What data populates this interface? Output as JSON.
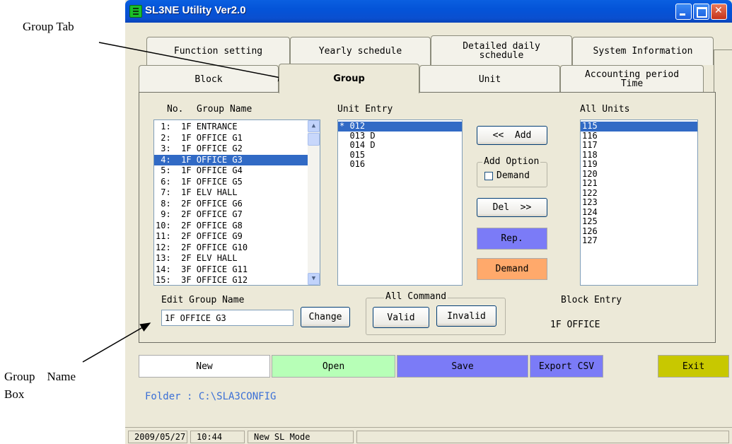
{
  "annotations": {
    "group_tab": "Group Tab",
    "group_name_box_line1": "Group　Name",
    "group_name_box_line2": "Box"
  },
  "window": {
    "title": "SL3NE Utility Ver2.0",
    "accent": "#0454d8"
  },
  "tabs_top": [
    {
      "label": "Function setting"
    },
    {
      "label": "Yearly schedule"
    },
    {
      "label": "Detailed daily\nschedule"
    },
    {
      "label": "System Information"
    }
  ],
  "tabs_bottom": [
    {
      "label": "Block"
    },
    {
      "label": "Group",
      "active": true
    },
    {
      "label": "Unit"
    },
    {
      "label": "Accounting period\nTime"
    }
  ],
  "group_list": {
    "header_no": "No.",
    "header_name": "Group Name",
    "selected_index": 3,
    "items": [
      " 1:  1F ENTRANCE",
      " 2:  1F OFFICE G1",
      " 3:  1F OFFICE G2",
      " 4:  1F OFFICE G3",
      " 5:  1F OFFICE G4",
      " 6:  1F OFFICE G5",
      " 7:  1F ELV HALL",
      " 8:  2F OFFICE G6",
      " 9:  2F OFFICE G7",
      "10:  2F OFFICE G8",
      "11:  2F OFFICE G9",
      "12:  2F OFFICE G10",
      "13:  2F ELV HALL",
      "14:  3F OFFICE G11",
      "15:  3F OFFICE G12"
    ]
  },
  "unit_entry": {
    "header": "Unit Entry",
    "items": [
      "* 012",
      "  013 D",
      "  014 D",
      "  015",
      "  016"
    ],
    "selected_index": 0
  },
  "all_units": {
    "header": "All Units",
    "items": [
      "115",
      "116",
      "117",
      "118",
      "119",
      "120",
      "121",
      "122",
      "123",
      "124",
      "125",
      "126",
      "127"
    ],
    "selected_index": 0
  },
  "buttons": {
    "add": "<<  Add",
    "add_option": "Add Option",
    "demand_check": "Demand",
    "del": "Del  >>",
    "rep": "Rep.",
    "demand": "Demand",
    "change": "Change",
    "valid": "Valid",
    "invalid": "Invalid",
    "all_command": "All Command",
    "rep_color": "#7b7bf7",
    "demand_color": "#ffa96b"
  },
  "edit_group": {
    "label": "Edit Group Name",
    "value": "1F OFFICE G3"
  },
  "block_entry": {
    "label": "Block Entry",
    "value": "1F OFFICE"
  },
  "bottom_buttons": [
    {
      "label": "New",
      "color": "#ffffff"
    },
    {
      "label": "Open",
      "color": "#b7ffb7"
    },
    {
      "label": "Save",
      "color": "#7b7bf7"
    },
    {
      "label": "Export CSV",
      "color": "#7b7bf7"
    },
    {
      "label": "Exit",
      "color": "#c8c800"
    }
  ],
  "folder": "Folder : C:\\SLA3CONFIG",
  "status": {
    "date": "2009/05/27",
    "time": "10:44",
    "mode": "New SL Mode"
  }
}
